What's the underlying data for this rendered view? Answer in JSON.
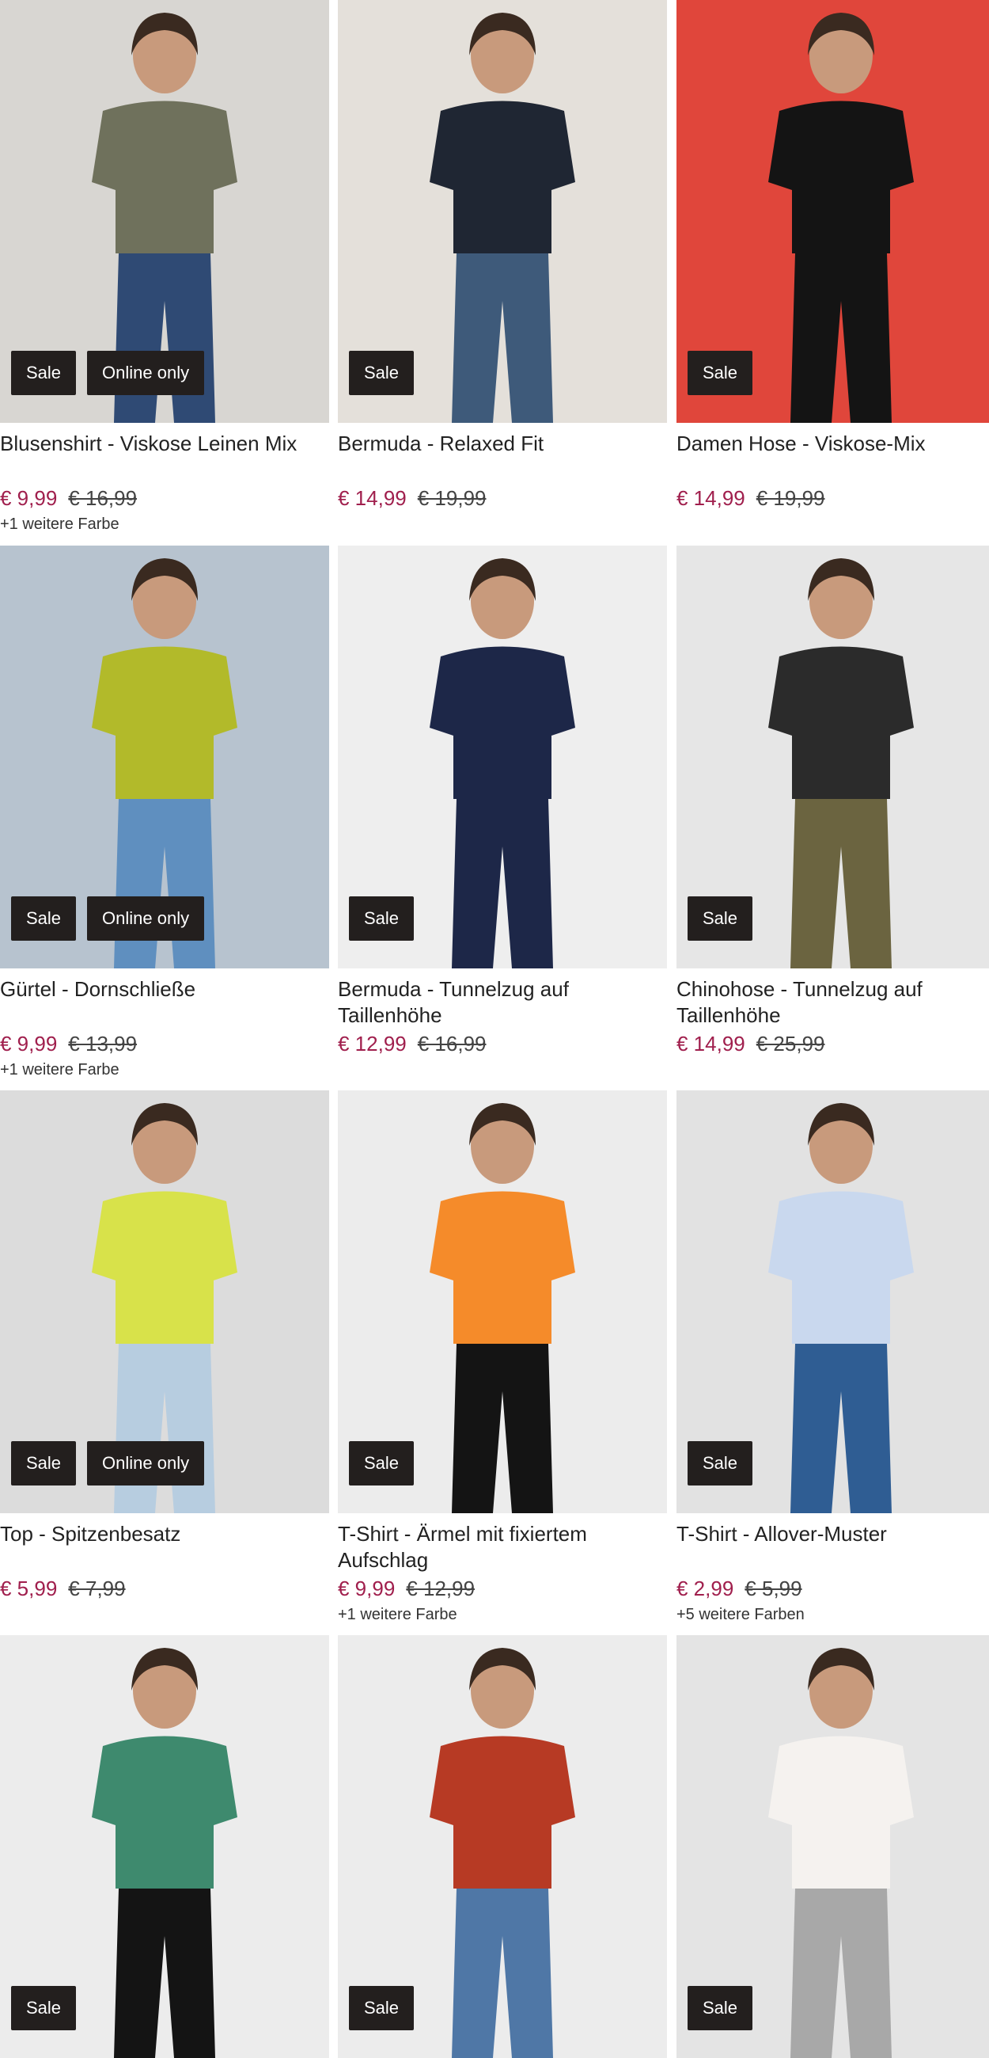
{
  "products": [
    {
      "title": "Blusenshirt - Viskose Leinen Mix",
      "price": "€ 9,99",
      "old_price": "€ 16,99",
      "colors": "+1 weitere Farbe",
      "badges": [
        "Sale",
        "Online only"
      ],
      "bg": "#d8d6d2",
      "garment": "#6f715c",
      "pants": "#2f4a74"
    },
    {
      "title": "Bermuda - Relaxed Fit",
      "price": "€ 14,99",
      "old_price": "€ 19,99",
      "colors": "",
      "badges": [
        "Sale"
      ],
      "bg": "#e4e0da",
      "garment": "#1f2633",
      "pants": "#3e5a7a"
    },
    {
      "title": "Damen Hose - Viskose-Mix",
      "price": "€ 14,99",
      "old_price": "€ 19,99",
      "colors": "",
      "badges": [
        "Sale"
      ],
      "bg": "#e0463b",
      "garment": "#141414",
      "pants": "#141414"
    },
    {
      "title": "Gürtel - Dornschließe",
      "price": "€ 9,99",
      "old_price": "€ 13,99",
      "colors": "+1 weitere Farbe",
      "badges": [
        "Sale",
        "Online only"
      ],
      "bg": "#b7c3cf",
      "garment": "#b2ba2a",
      "pants": "#5f8fbf"
    },
    {
      "title": "Bermuda - Tunnelzug auf Taillenhöhe",
      "price": "€ 12,99",
      "old_price": "€ 16,99",
      "colors": "",
      "badges": [
        "Sale"
      ],
      "bg": "#eeeeee",
      "garment": "#1d2748",
      "pants": "#1d2748"
    },
    {
      "title": "Chinohose - Tunnelzug auf Taillenhöhe",
      "price": "€ 14,99",
      "old_price": "€ 25,99",
      "colors": "",
      "badges": [
        "Sale"
      ],
      "bg": "#e6e6e6",
      "garment": "#2b2b2b",
      "pants": "#6b6440"
    },
    {
      "title": "Top - Spitzenbesatz",
      "price": "€ 5,99",
      "old_price": "€ 7,99",
      "colors": "",
      "badges": [
        "Sale",
        "Online only"
      ],
      "bg": "#dcdcdc",
      "garment": "#d8e24a",
      "pants": "#b7cde0"
    },
    {
      "title": "T-Shirt - Ärmel mit fixiertem Aufschlag",
      "price": "€ 9,99",
      "old_price": "€ 12,99",
      "colors": "+1 weitere Farbe",
      "badges": [
        "Sale"
      ],
      "bg": "#ececec",
      "garment": "#f58b2a",
      "pants": "#141414"
    },
    {
      "title": "T-Shirt - Allover-Muster",
      "price": "€ 2,99",
      "old_price": "€ 5,99",
      "colors": "+5 weitere Farben",
      "badges": [
        "Sale"
      ],
      "bg": "#e2e2e2",
      "garment": "#c9d8ee",
      "pants": "#2f5d93"
    },
    {
      "title": "",
      "price": "",
      "old_price": "",
      "colors": "",
      "badges": [
        "Sale"
      ],
      "bg": "#ececec",
      "garment": "#3e8a6e",
      "pants": "#141414"
    },
    {
      "title": "",
      "price": "",
      "old_price": "",
      "colors": "",
      "badges": [
        "Sale"
      ],
      "bg": "#ececec",
      "garment": "#b73a24",
      "pants": "#4f77a6"
    },
    {
      "title": "",
      "price": "",
      "old_price": "",
      "colors": "",
      "badges": [
        "Sale"
      ],
      "bg": "#e4e4e4",
      "garment": "#f5f2ef",
      "pants": "#a8a8a8"
    }
  ]
}
